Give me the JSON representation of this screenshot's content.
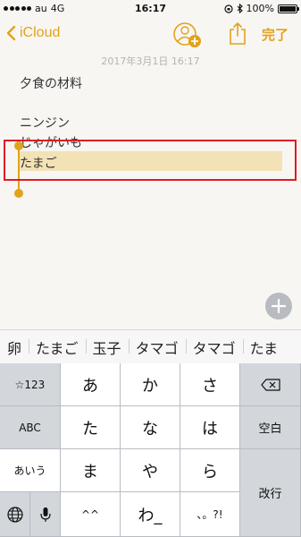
{
  "status_bar": {
    "carrier": "au",
    "network": "4G",
    "time": "16:17",
    "battery": "100%"
  },
  "nav_bar": {
    "back_label": "iCloud",
    "done_label": "完了",
    "accent_color": "#e3a21a"
  },
  "note": {
    "date": "2017年3月1日 16:17",
    "lines": [
      "夕食の材料",
      "ニンジン",
      "じゃがいも",
      "たまご"
    ],
    "selected_line": "たまご"
  },
  "suggestions": [
    "卵",
    "たまご",
    "玉子",
    "タマゴ",
    "タマゴ",
    "たま"
  ],
  "keyboard": {
    "left_keys": [
      "☆123",
      "ABC",
      "あいう"
    ],
    "kana": [
      [
        "あ",
        "か",
        "さ"
      ],
      [
        "た",
        "な",
        "は"
      ],
      [
        "ま",
        "や",
        "ら"
      ],
      [
        "^^",
        "わ_",
        "、。?!"
      ]
    ],
    "space_label": "空白",
    "return_label": "改行",
    "delete_icon": "delete-key-icon",
    "globe_icon": "globe-icon",
    "mic_icon": "microphone-icon"
  }
}
